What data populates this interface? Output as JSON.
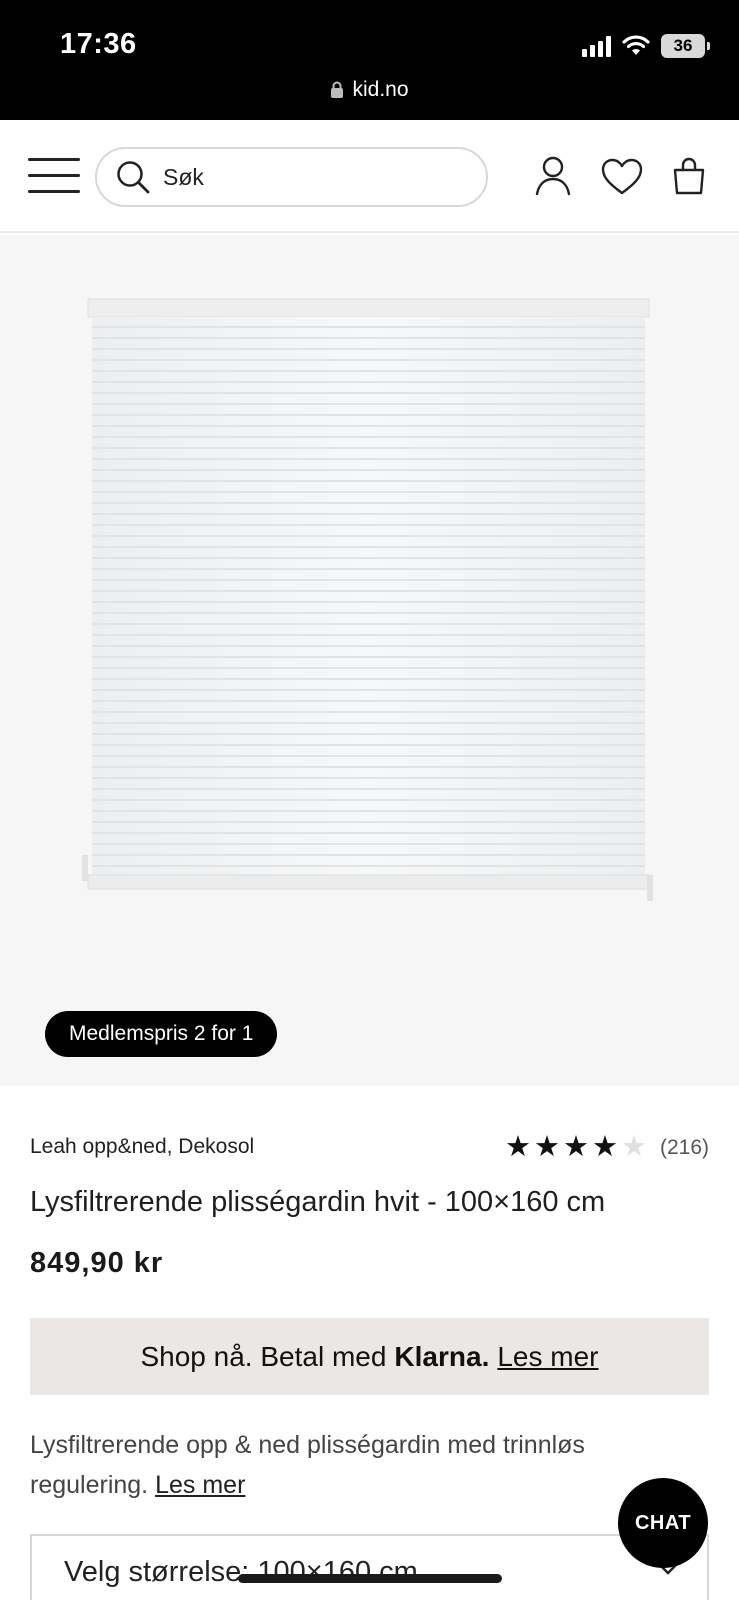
{
  "status_bar": {
    "time": "17:36",
    "battery": "36",
    "url": "kid.no"
  },
  "header": {
    "search_placeholder": "Søk"
  },
  "product": {
    "badge": "Medlemspris 2 for 1",
    "brand": "Leah opp&ned, Dekosol",
    "rating": 4,
    "rating_max": 5,
    "rating_count": "(216)",
    "title": "Lysfiltrerende plisségardin hvit - 100×160 cm",
    "price": "849,90 kr"
  },
  "klarna": {
    "text": "Shop nå. Betal med",
    "brand": "Klarna.",
    "link": "Les mer"
  },
  "description": {
    "text": "Lysfiltrerende opp & ned plisségardin med trinnløs regulering.",
    "link": "Les mer"
  },
  "size_select": {
    "label": "Velg størrelse: 100×160 cm"
  },
  "chat": {
    "label": "CHAT"
  },
  "colors": {
    "accent": "#000000",
    "klarna_bg": "#ebe7e4",
    "image_bg": "#f6f6f6"
  }
}
